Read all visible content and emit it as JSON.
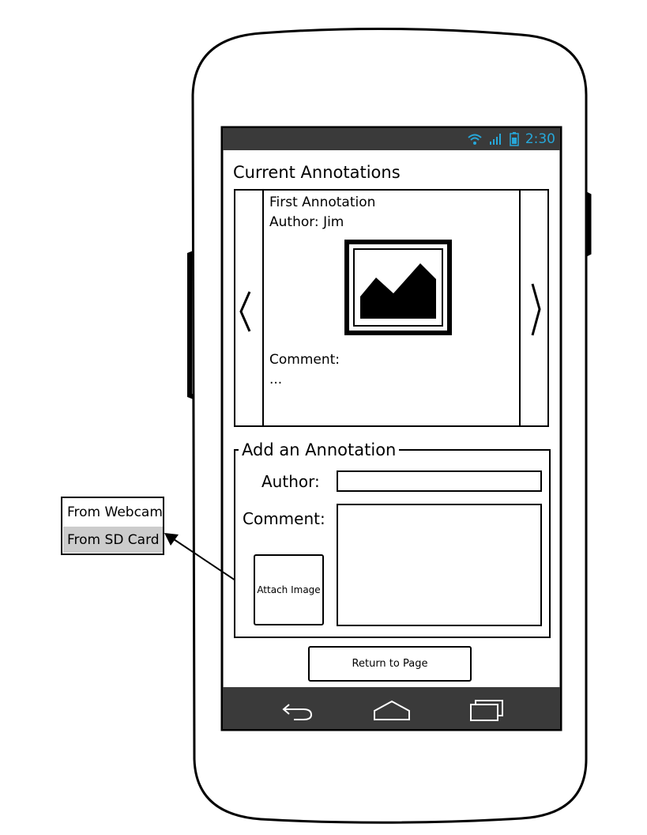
{
  "status_bar": {
    "time": "2:30",
    "icons": [
      "wifi-icon",
      "signal-icon",
      "battery-icon"
    ],
    "accent_color": "#27a7d9"
  },
  "current_annotations": {
    "title": "Current Annotations",
    "annotation": {
      "title": "First Annotation",
      "author": "Author: Jim",
      "image": "image-placeholder-icon",
      "comment_label": "Comment:",
      "comment_text": "..."
    },
    "prev_icon": "chevron-left-icon",
    "next_icon": "chevron-right-icon"
  },
  "add_annotation": {
    "title": "Add an Annotation",
    "author_label": "Author:",
    "author_value": "",
    "comment_label": "Comment:",
    "comment_value": "",
    "attach_image_label": "Attach Image"
  },
  "return_button": {
    "label": "Return to Page"
  },
  "nav_bar": {
    "icons": [
      "back-icon",
      "home-icon",
      "recent-apps-icon"
    ]
  },
  "attach_menu": {
    "items": [
      {
        "label": "From Webcam",
        "selected": false
      },
      {
        "label": "From SD Card",
        "selected": true
      }
    ],
    "selected_color": "#cccccc"
  }
}
